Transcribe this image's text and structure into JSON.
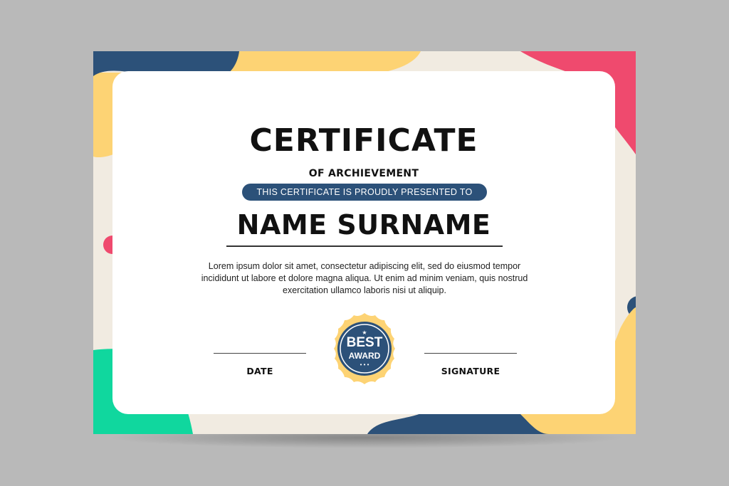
{
  "certificate": {
    "title": "CERTIFICATE",
    "subtitle": "OF ARCHIEVEMENT",
    "presented_text": "THIS CERTIFICATE IS PROUDLY PRESENTED TO",
    "recipient_name": "NAME SURNAME",
    "body_text": "Lorem ipsum dolor sit amet, consectetur adipiscing elit, sed do eiusmod tempor incididunt ut labore et dolore magna aliqua. Ut enim ad minim veniam, quis nostrud exercitation ullamco laboris nisi ut aliquip.",
    "date_label": "DATE",
    "signature_label": "SIGNATURE",
    "badge": {
      "line1": "BEST",
      "line2": "AWARD",
      "star": "★",
      "dots": "• • •"
    }
  },
  "colors": {
    "navy": "#2c5179",
    "yellow": "#fdd374",
    "pink": "#ef4a6e",
    "green": "#10d79e",
    "cream": "#f1ebe1",
    "background": "#b9b9b9"
  }
}
